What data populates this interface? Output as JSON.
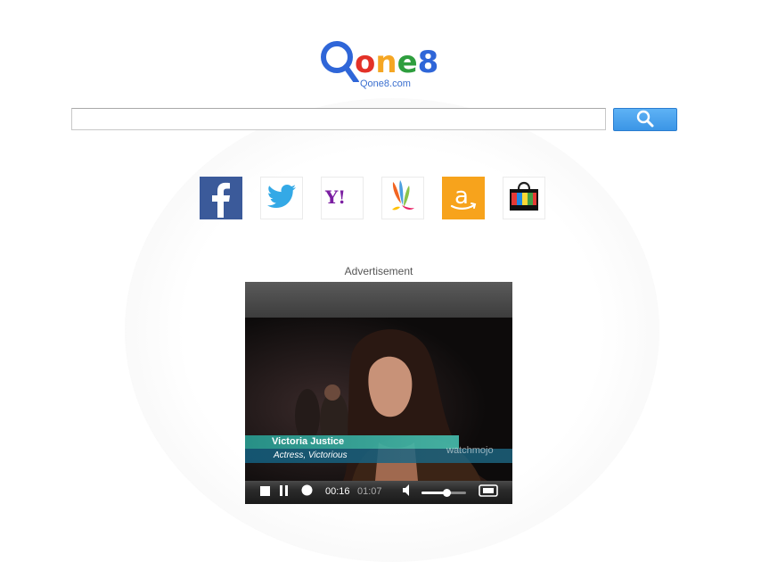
{
  "logo": {
    "letters": [
      "Q",
      "o",
      "n",
      "e",
      "8"
    ],
    "colors": [
      "#2f66d8",
      "#e33127",
      "#f5a623",
      "#2e9e3e",
      "#2f66d8"
    ],
    "subtitle": "Qone8.com"
  },
  "search": {
    "value": "",
    "placeholder": "",
    "button_icon": "magnifier-icon"
  },
  "quick_links": [
    {
      "name": "facebook",
      "glyph": "f",
      "color": "#3b5a9a"
    },
    {
      "name": "twitter",
      "glyph": "bird",
      "color": "#34a9e6"
    },
    {
      "name": "yahoo",
      "glyph": "Y!",
      "color": "#7b1fa2"
    },
    {
      "name": "games",
      "glyph": "leaf",
      "color": "#f26522"
    },
    {
      "name": "amazon",
      "glyph": "a",
      "color": "#f7a31c"
    },
    {
      "name": "shopping",
      "glyph": "bag",
      "color": "#1a1a1a"
    }
  ],
  "advertisement": {
    "label": "Advertisement",
    "video": {
      "caption_name": "Victoria Justice",
      "caption_role": "Actress, Victorious",
      "watermark": "watchmojo",
      "time_current": "00:16",
      "time_total": "01:07",
      "volume": 0.55
    }
  }
}
